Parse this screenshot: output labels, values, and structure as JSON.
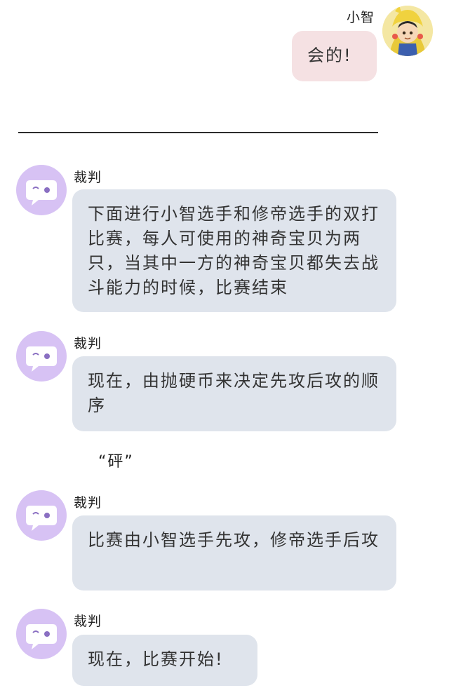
{
  "user": {
    "name": "小智",
    "avatar_icon": "pikachu-hood-avatar-icon"
  },
  "user_message": "会的!",
  "judge": {
    "avatar_icon": "chat-bubble-face-icon",
    "avatar_color": "#d7c2f4"
  },
  "messages": [
    {
      "sender": "裁判",
      "text": "下面进行小智选手和修帝选手的双打比赛，每人可使用的神奇宝贝为两只，当其中一方的神奇宝贝都失去战斗能力的时候，比赛结束"
    },
    {
      "sender": "裁判",
      "text": "现在，由抛硬币来决定先攻后攻的顺序"
    },
    {
      "sender": "裁判",
      "text": "比赛由小智选手先攻，修帝选手后攻"
    },
    {
      "sender": "裁判",
      "text": "现在，比赛开始!"
    }
  ],
  "sound_effect": "“砰”",
  "colors": {
    "bubble": "#dfe4ec",
    "user_bubble": "#f5e1e3",
    "background": "#ffffff"
  }
}
